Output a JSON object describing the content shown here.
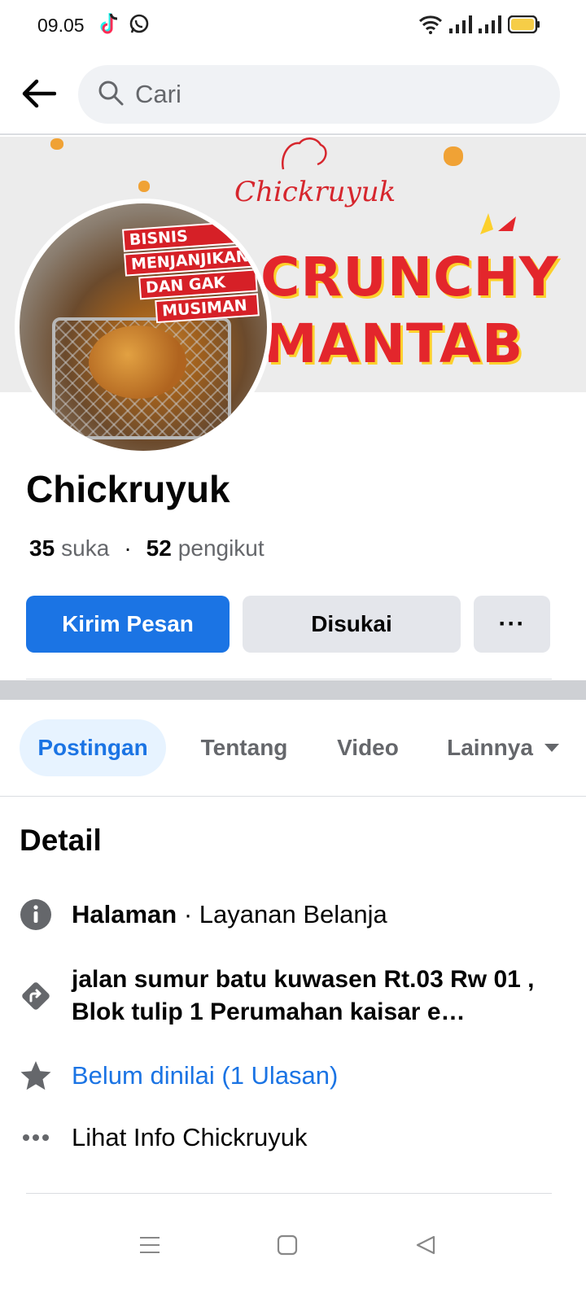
{
  "status_bar": {
    "time": "09.05",
    "left_icons": [
      "tiktok-icon",
      "whatsapp-icon"
    ],
    "right_icons": [
      "wifi-icon",
      "signal-icon",
      "signal-icon",
      "battery-icon"
    ]
  },
  "search": {
    "placeholder": "Cari"
  },
  "cover": {
    "brand": "Chickruyuk",
    "headline_1": "CRUNCHY",
    "headline_2": "MANTAB"
  },
  "avatar": {
    "badge_lines": [
      "BISNIS",
      "MENJANJIKAN",
      "DAN GAK",
      "MUSIMAN"
    ]
  },
  "page": {
    "name": "Chickruyuk",
    "likes_count": "35",
    "likes_label": "suka",
    "separator": "·",
    "followers_count": "52",
    "followers_label": "pengikut"
  },
  "actions": {
    "message": "Kirim Pesan",
    "liked": "Disukai",
    "more": "···"
  },
  "tabs": [
    {
      "label": "Postingan",
      "active": true
    },
    {
      "label": "Tentang",
      "active": false
    },
    {
      "label": "Video",
      "active": false
    },
    {
      "label": "Lainnya",
      "active": false
    }
  ],
  "detail": {
    "title": "Detail",
    "category_bold": "Halaman",
    "category_rest": " · Layanan Belanja",
    "address": "jalan sumur batu kuwasen Rt.03 Rw 01 , Blok tulip 1 Perumahan kaisar e…",
    "rating": "Belum dinilai (1 Ulasan)",
    "see_info": "Lihat Info Chickruyuk"
  },
  "colors": {
    "primary": "#1b74e4",
    "secondary_bg": "#e4e6eb",
    "muted_text": "#65676b",
    "active_tab_bg": "#e7f3ff",
    "brand_red": "#e3262c"
  }
}
